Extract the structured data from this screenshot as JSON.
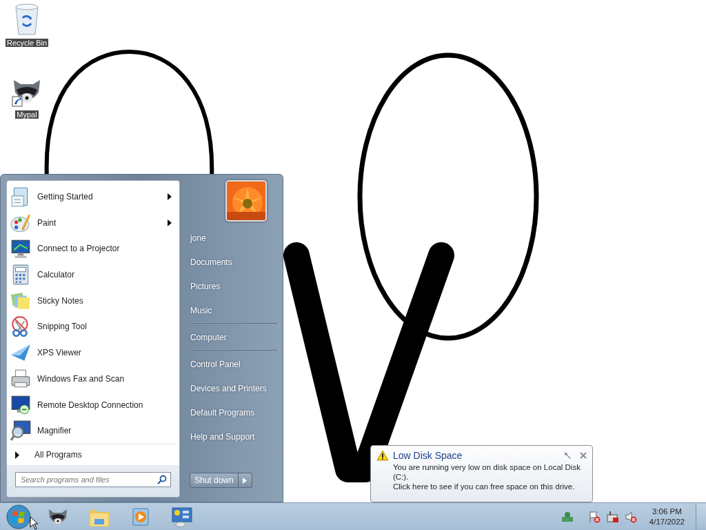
{
  "desktop": {
    "icons": [
      {
        "label": "Recycle Bin"
      },
      {
        "label": "Mypal"
      }
    ]
  },
  "start_menu": {
    "programs": [
      {
        "label": "Getting Started",
        "submenu": true
      },
      {
        "label": "Paint",
        "submenu": true
      },
      {
        "label": "Connect to a Projector",
        "submenu": false
      },
      {
        "label": "Calculator",
        "submenu": false
      },
      {
        "label": "Sticky Notes",
        "submenu": false
      },
      {
        "label": "Snipping Tool",
        "submenu": false
      },
      {
        "label": "XPS Viewer",
        "submenu": false
      },
      {
        "label": "Windows Fax and Scan",
        "submenu": false
      },
      {
        "label": "Remote Desktop Connection",
        "submenu": false
      },
      {
        "label": "Magnifier",
        "submenu": false
      }
    ],
    "all_programs": "All Programs",
    "search": {
      "placeholder": "Search programs and files"
    },
    "place_groups": [
      {
        "places": [
          {
            "label": "jone"
          },
          {
            "label": "Documents"
          },
          {
            "label": "Pictures"
          },
          {
            "label": "Music"
          }
        ]
      },
      {
        "places": [
          {
            "label": "Computer"
          }
        ]
      },
      {
        "places": [
          {
            "label": "Control Panel"
          },
          {
            "label": "Devices and Printers"
          },
          {
            "label": "Default Programs"
          },
          {
            "label": "Help and Support"
          }
        ]
      }
    ],
    "shutdown": "Shut down"
  },
  "notification": {
    "title": "Low Disk Space",
    "lines": [
      "You are running very low on disk space on Local Disk (C:).",
      "Click here to see if you can free space on this drive."
    ]
  },
  "taskbar": {
    "clock": {
      "time": "3:06 PM",
      "date": "4/17/2022"
    }
  }
}
